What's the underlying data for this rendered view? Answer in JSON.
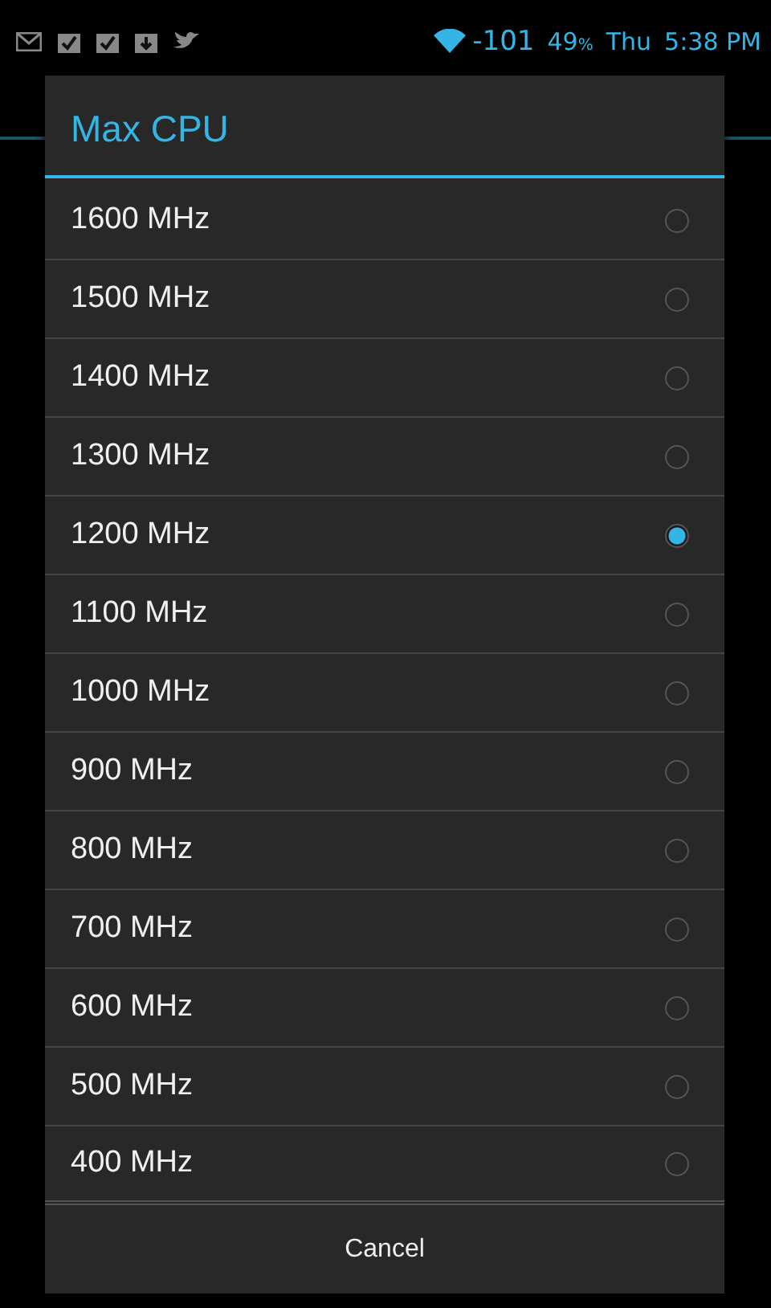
{
  "status_bar": {
    "signal": "-101",
    "battery": "49",
    "battery_unit": "%",
    "day": "Thu",
    "time": "5:38 PM"
  },
  "dialog": {
    "title": "Max CPU",
    "options": [
      {
        "label": "1600 MHz",
        "selected": false
      },
      {
        "label": "1500 MHz",
        "selected": false
      },
      {
        "label": "1400 MHz",
        "selected": false
      },
      {
        "label": "1300 MHz",
        "selected": false
      },
      {
        "label": "1200 MHz",
        "selected": true
      },
      {
        "label": "1100 MHz",
        "selected": false
      },
      {
        "label": "1000 MHz",
        "selected": false
      },
      {
        "label": "900 MHz",
        "selected": false
      },
      {
        "label": "800 MHz",
        "selected": false
      },
      {
        "label": "700 MHz",
        "selected": false
      },
      {
        "label": "600 MHz",
        "selected": false
      },
      {
        "label": "500 MHz",
        "selected": false
      },
      {
        "label": "400 MHz",
        "selected": false
      }
    ],
    "cancel": "Cancel"
  }
}
